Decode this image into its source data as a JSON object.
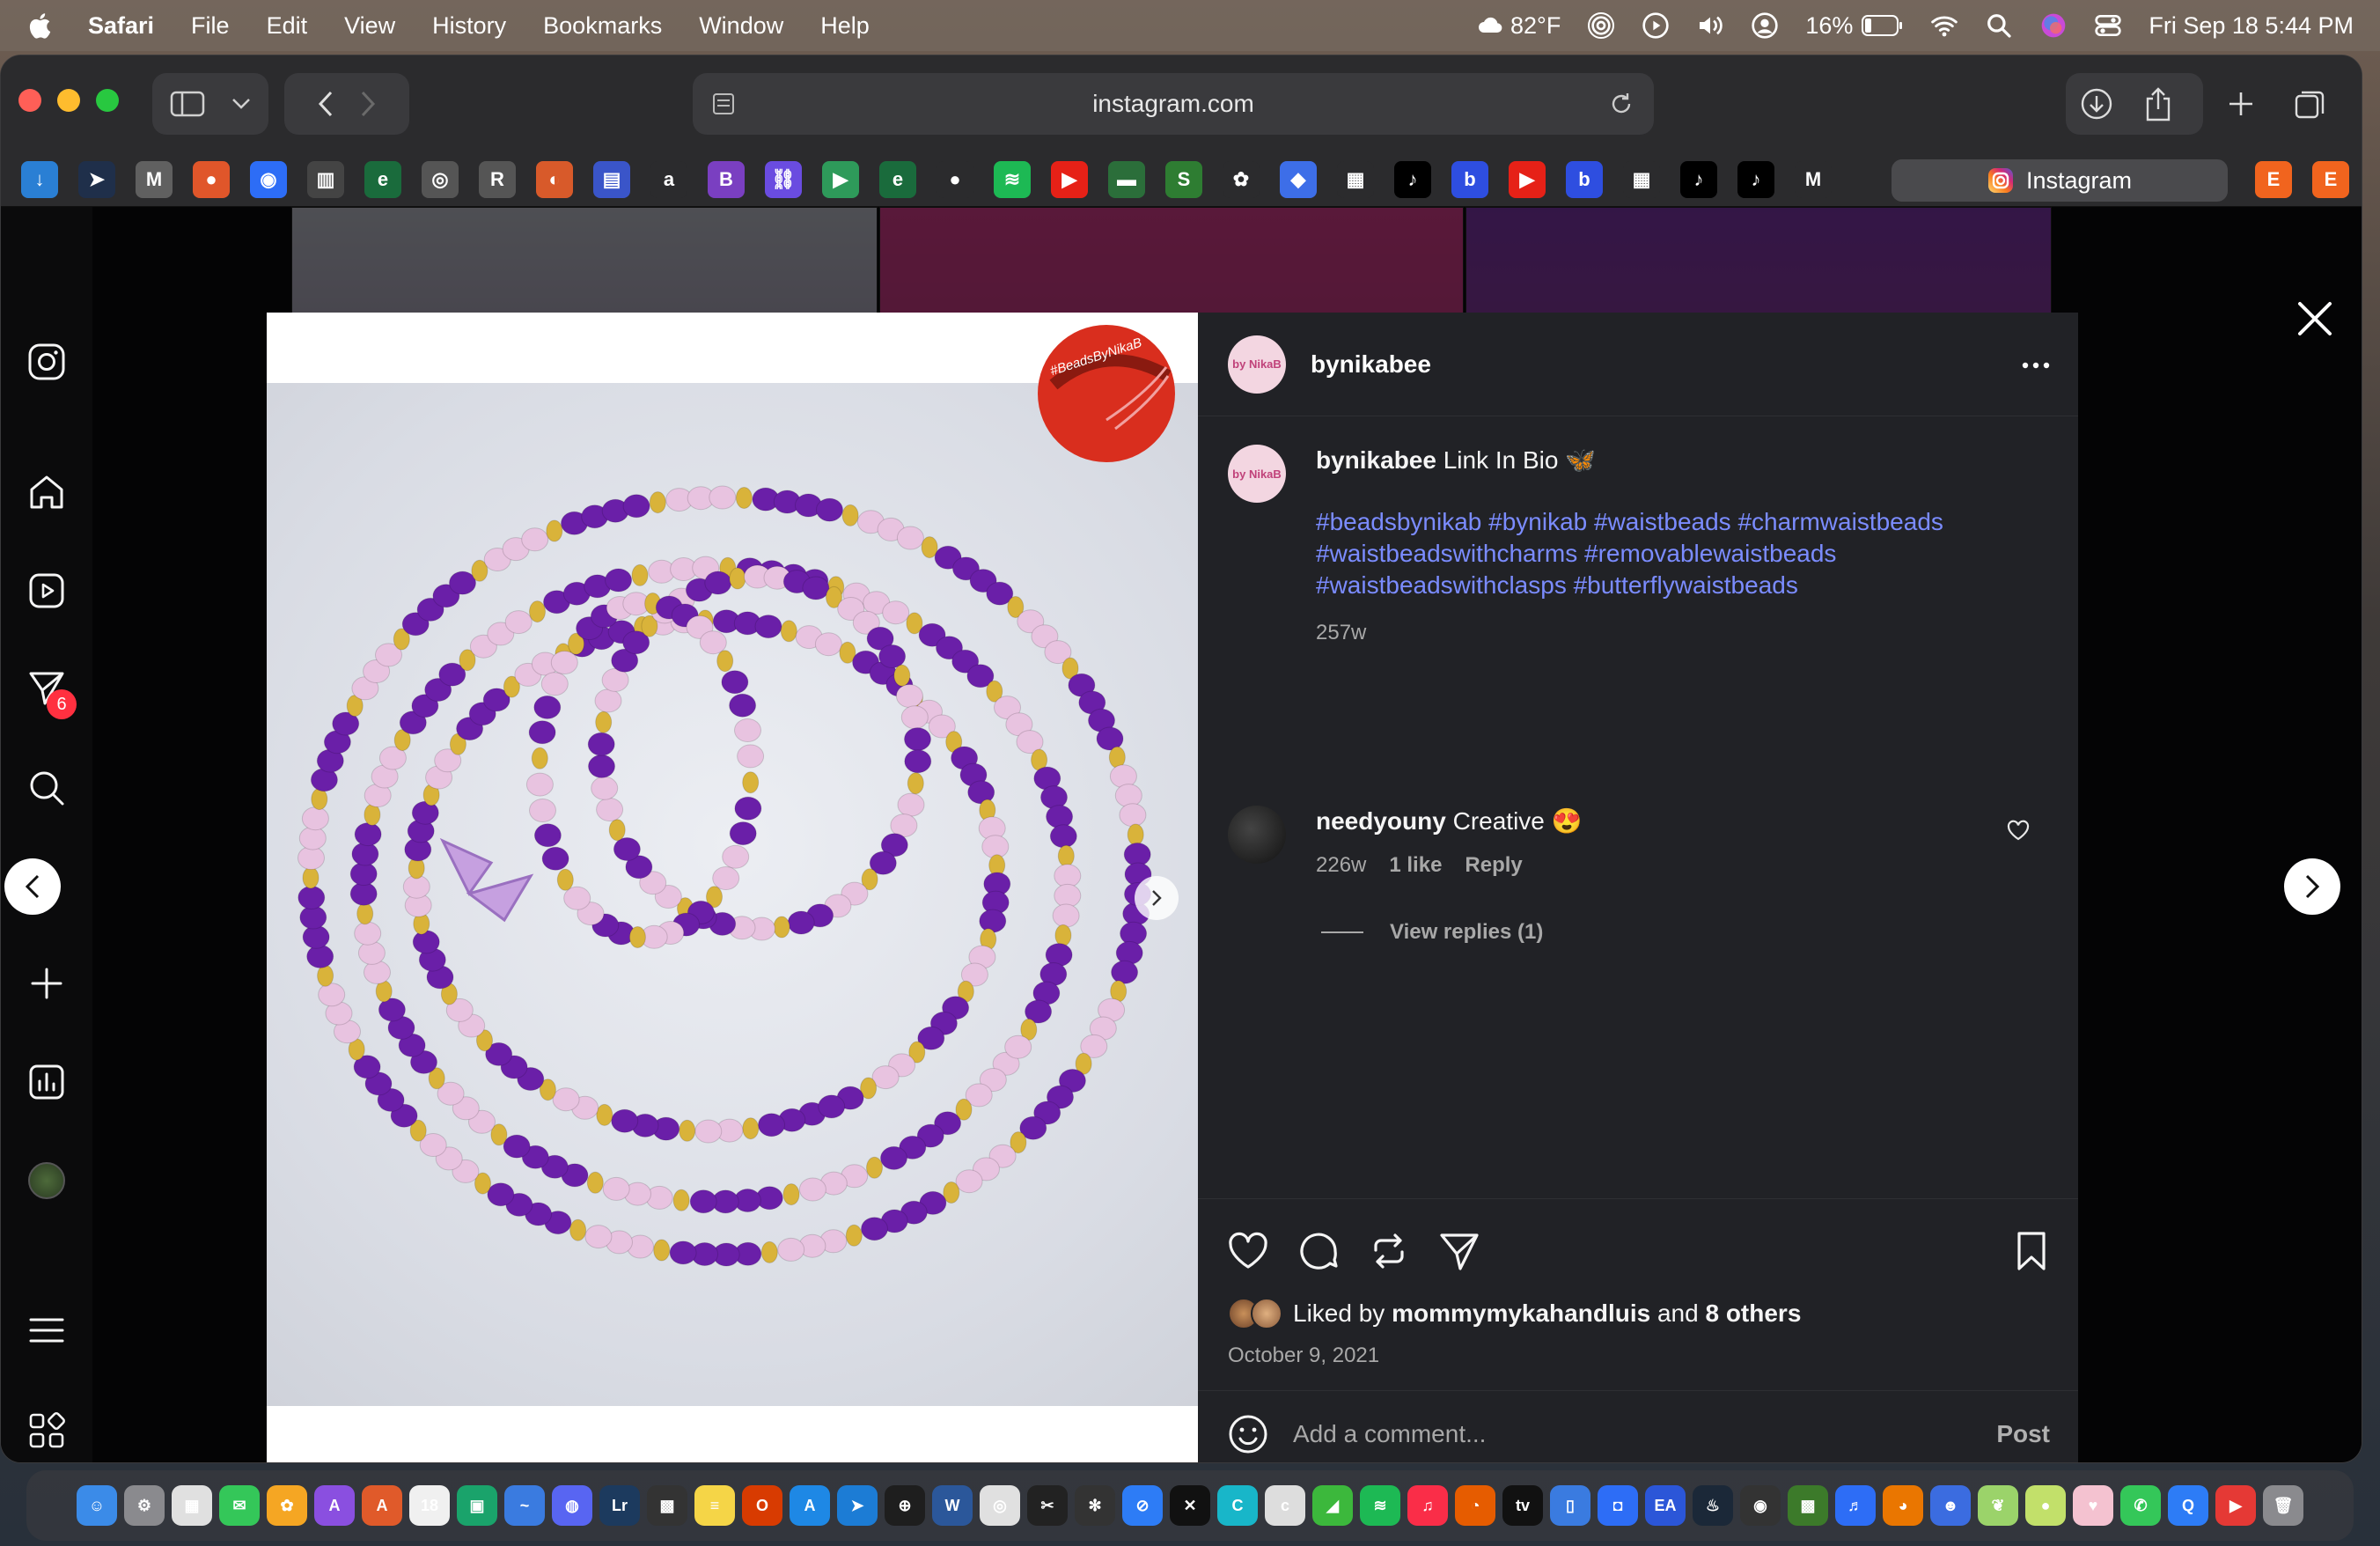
{
  "menubar": {
    "app_name": "Safari",
    "items": [
      "File",
      "Edit",
      "View",
      "History",
      "Bookmarks",
      "Window",
      "Help"
    ],
    "weather": "82°F",
    "battery": "16%",
    "datetime": "Fri Sep 18  5:44 PM"
  },
  "browser": {
    "url": "instagram.com",
    "active_tab_label": "Instagram",
    "favorites": [
      {
        "name": "download-fav",
        "color": "#2a7fd4",
        "glyph": "↓"
      },
      {
        "name": "arrow-fav",
        "color": "#1f2f4a",
        "glyph": "➤"
      },
      {
        "name": "gmail-m-fav",
        "color": "#606060",
        "glyph": "M"
      },
      {
        "name": "ball-fav",
        "color": "#e0562a",
        "glyph": "●"
      },
      {
        "name": "blue-dot-fav",
        "color": "#2d6df6",
        "glyph": "◉"
      },
      {
        "name": "bars-fav",
        "color": "#444",
        "glyph": "▥"
      },
      {
        "name": "e-fav",
        "color": "#1a6b3c",
        "glyph": "e"
      },
      {
        "name": "target-fav",
        "color": "#555",
        "glyph": "◎"
      },
      {
        "name": "r-fav",
        "color": "#555",
        "glyph": "R"
      },
      {
        "name": "swirl-fav",
        "color": "#d85a2a",
        "glyph": "◐"
      },
      {
        "name": "book-fav",
        "color": "#3a55c9",
        "glyph": "▤"
      },
      {
        "name": "amazon-fav",
        "color": "#2b2b2d",
        "glyph": "a"
      },
      {
        "name": "b-square-fav",
        "color": "#7a3fc1",
        "glyph": "B"
      },
      {
        "name": "link-fav",
        "color": "#6a4ce0",
        "glyph": "⛓"
      },
      {
        "name": "play-fav",
        "color": "#2e9a5a",
        "glyph": "▶"
      },
      {
        "name": "e2-fav",
        "color": "#1a6b3c",
        "glyph": "e"
      },
      {
        "name": "red-dot-fav",
        "color": "#2b2b2d",
        "glyph": "●"
      },
      {
        "name": "spotify-fav",
        "color": "#1db954",
        "glyph": "≋"
      },
      {
        "name": "youtube-fav",
        "color": "#e62117",
        "glyph": "▶"
      },
      {
        "name": "green-bar-fav",
        "color": "#2b6e3a",
        "glyph": "▬"
      },
      {
        "name": "s-fav",
        "color": "#2e7d32",
        "glyph": "S"
      },
      {
        "name": "pinwheel-fav",
        "color": "#2b2b2d",
        "glyph": "✿"
      },
      {
        "name": "roblox-fav",
        "color": "#3d6ee8",
        "glyph": "◆"
      },
      {
        "name": "grid-fav",
        "color": "#2b2b2d",
        "glyph": "▦"
      },
      {
        "name": "tiktok-fav",
        "color": "#000",
        "glyph": "♪"
      },
      {
        "name": "b-fav",
        "color": "#2e4ee0",
        "glyph": "b"
      },
      {
        "name": "youtube2-fav",
        "color": "#e62117",
        "glyph": "▶"
      },
      {
        "name": "b2-fav",
        "color": "#2e4ee0",
        "glyph": "b"
      },
      {
        "name": "grid2-fav",
        "color": "#2b2b2d",
        "glyph": "▦"
      },
      {
        "name": "tiktok2-fav",
        "color": "#000",
        "glyph": "♪"
      },
      {
        "name": "tiktok3-fav",
        "color": "#000",
        "glyph": "♪"
      },
      {
        "name": "gmail-fav",
        "color": "#2b2b2d",
        "glyph": "M"
      }
    ],
    "trailing_favorites": [
      {
        "name": "etsy-fav",
        "color": "#f1641e",
        "glyph": "E"
      },
      {
        "name": "etsy2-fav",
        "color": "#f1641e",
        "glyph": "E"
      }
    ]
  },
  "sidebar": {
    "notification_count": "6"
  },
  "post": {
    "username": "bynikabee",
    "avatar_text": "by NikaB",
    "logo_text": "#BeadsByNikaB",
    "caption": "Link In Bio 🦋",
    "hashtags": "#beadsbynikab #bynikab #waistbeads #charmwaistbeads #waistbeadswithcharms #removablewaistbeads #waistbeadswithclasps #butterflywaistbeads",
    "caption_age": "257w",
    "comment": {
      "username": "needyouny",
      "text": "Creative 😍",
      "age": "226w",
      "likes": "1 like",
      "reply_label": "Reply",
      "view_replies": "View replies (1)"
    },
    "liked_by_prefix": "Liked by",
    "liked_by_user": "mommymykahandluis",
    "liked_by_conj": "and",
    "liked_by_others": "8 others",
    "date": "October 9, 2021",
    "comment_placeholder": "Add a comment...",
    "post_label": "Post"
  },
  "colors": {
    "hashtag": "#7b8cff",
    "bead_purple": "#6a1fa8",
    "bead_pink": "#e8c3e0",
    "bead_gold": "#d9b33a",
    "logo_red": "#d92e1e"
  },
  "dock_apps": [
    {
      "name": "finder",
      "color": "#3b8be8",
      "glyph": "☺"
    },
    {
      "name": "settings",
      "color": "#8a8a8e",
      "glyph": "⚙"
    },
    {
      "name": "launchpad",
      "color": "#e0e0e0",
      "glyph": "▦"
    },
    {
      "name": "messages",
      "color": "#34c759",
      "glyph": "✉"
    },
    {
      "name": "photos",
      "color": "#f5a623",
      "glyph": "✿"
    },
    {
      "name": "affinity",
      "color": "#8a4fe0",
      "glyph": "A"
    },
    {
      "name": "affinity2",
      "color": "#e05a2a",
      "glyph": "A"
    },
    {
      "name": "calendar",
      "color": "#f0f0f0",
      "glyph": "18"
    },
    {
      "name": "bus",
      "color": "#1aa36b",
      "glyph": "▣"
    },
    {
      "name": "freeform",
      "color": "#3a7be0",
      "glyph": "~"
    },
    {
      "name": "discord",
      "color": "#5865f2",
      "glyph": "◍"
    },
    {
      "name": "lightroom",
      "color": "#1c3a5e",
      "glyph": "Lr"
    },
    {
      "name": "clapper",
      "color": "#333",
      "glyph": "▩"
    },
    {
      "name": "notes",
      "color": "#f5d547",
      "glyph": "≡"
    },
    {
      "name": "office",
      "color": "#d83b01",
      "glyph": "O"
    },
    {
      "name": "appstore",
      "color": "#1e88e5",
      "glyph": "A"
    },
    {
      "name": "telegram",
      "color": "#1c7cd5",
      "glyph": "➤"
    },
    {
      "name": "safari2",
      "color": "#1e1e1e",
      "glyph": "⊕"
    },
    {
      "name": "word",
      "color": "#2b579a",
      "glyph": "W"
    },
    {
      "name": "chrome",
      "color": "#e0e0e0",
      "glyph": "◎"
    },
    {
      "name": "finalcut",
      "color": "#222",
      "glyph": "✂"
    },
    {
      "name": "chatgpt",
      "color": "#333",
      "glyph": "✻"
    },
    {
      "name": "safari",
      "color": "#2d7cf6",
      "glyph": "⊘"
    },
    {
      "name": "capcut",
      "color": "#111",
      "glyph": "✕"
    },
    {
      "name": "canva",
      "color": "#18b6c9",
      "glyph": "C"
    },
    {
      "name": "cricut",
      "color": "#ddd",
      "glyph": "c"
    },
    {
      "name": "green-app",
      "color": "#3cb83c",
      "glyph": "◢"
    },
    {
      "name": "spotify",
      "color": "#1db954",
      "glyph": "≋"
    },
    {
      "name": "music",
      "color": "#fa2d48",
      "glyph": "♫"
    },
    {
      "name": "firefox",
      "color": "#e65c00",
      "glyph": "◔"
    },
    {
      "name": "appletv",
      "color": "#111",
      "glyph": "tv"
    },
    {
      "name": "files",
      "color": "#3a7be0",
      "glyph": "▯"
    },
    {
      "name": "box",
      "color": "#2d6df6",
      "glyph": "◘"
    },
    {
      "name": "ea",
      "color": "#2b56d8",
      "glyph": "EA"
    },
    {
      "name": "steam",
      "color": "#1b2838",
      "glyph": "♨"
    },
    {
      "name": "obs",
      "color": "#333",
      "glyph": "◉"
    },
    {
      "name": "minecraft",
      "color": "#3c7a2a",
      "glyph": "▩"
    },
    {
      "name": "headphones",
      "color": "#2d6df6",
      "glyph": "♬"
    },
    {
      "name": "blender",
      "color": "#ea7600",
      "glyph": "◕"
    },
    {
      "name": "blue-face",
      "color": "#3b6ce0",
      "glyph": "☻"
    },
    {
      "name": "green-leaf",
      "color": "#9bd36a",
      "glyph": "❦"
    },
    {
      "name": "lime",
      "color": "#c2e06a",
      "glyph": "●"
    },
    {
      "name": "heart-app",
      "color": "#f4c2d0",
      "glyph": "♥"
    },
    {
      "name": "phone",
      "color": "#34c759",
      "glyph": "✆"
    },
    {
      "name": "quicktime",
      "color": "#2d7cf6",
      "glyph": "Q"
    },
    {
      "name": "facetime",
      "color": "#e53935",
      "glyph": "▶"
    },
    {
      "name": "trash",
      "color": "#8a8a8e",
      "glyph": "🗑"
    }
  ]
}
